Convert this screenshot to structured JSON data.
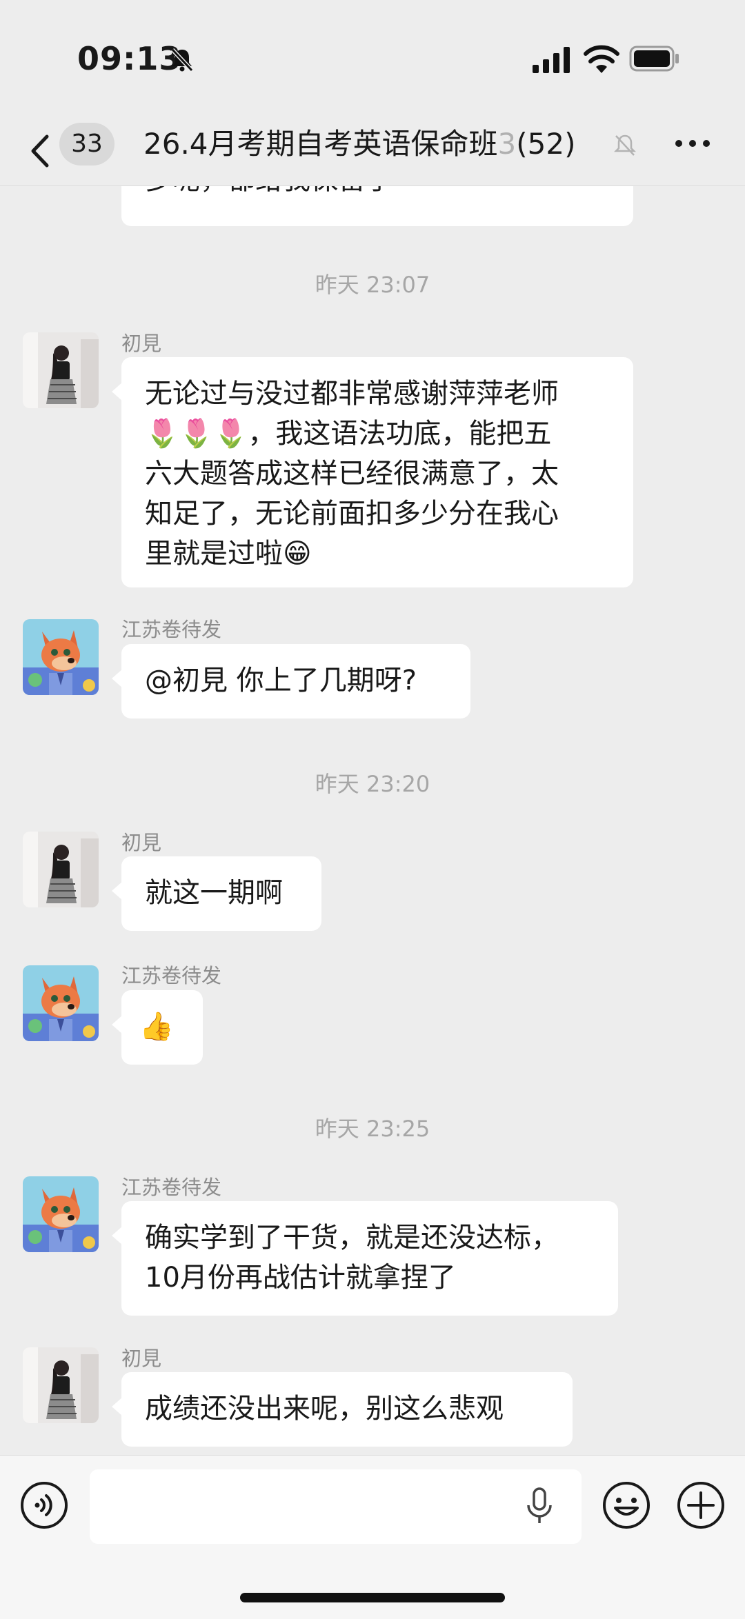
{
  "status_bar": {
    "time": "09:13",
    "icons": [
      "bell-slash-icon",
      "signal-icon",
      "wifi-icon",
      "battery-icon"
    ]
  },
  "header": {
    "back_icon": "chevron-left-icon",
    "unread_count": "33",
    "title_main": "26.4月考期自考英语保命班",
    "title_faded": "3",
    "member_count": "(52)",
    "mute_icon": "bell-slash-icon",
    "more_icon": "more-dots-icon"
  },
  "messages": {
    "partial_top": "多呢，都给我保留了",
    "ts1": "昨天 23:07",
    "m1": {
      "sender": "初見",
      "line1": "无论过与没过都非常感谢萍萍老师",
      "line2": "🌷🌷🌷，我这语法功底，能把五",
      "line3": "六大题答成这样已经很满意了，太",
      "line4": "知足了，无论前面扣多少分在我心",
      "line5": "里就是过啦😁"
    },
    "m2": {
      "sender": "江苏卷待发",
      "text": "@初見 你上了几期呀?"
    },
    "ts2": "昨天 23:20",
    "m3": {
      "sender": "初見",
      "text": "就这一期啊"
    },
    "m4": {
      "sender": "江苏卷待发",
      "text": "👍"
    },
    "ts3": "昨天 23:25",
    "m5": {
      "sender": "江苏卷待发",
      "line1": "确实学到了干货，就是还没达标，",
      "line2": "10月份再战估计就拿捏了"
    },
    "m6": {
      "sender": "初見",
      "text": "成绩还没出来呢，别这么悲观"
    }
  },
  "input_bar": {
    "voice_icon": "voice-mode-icon",
    "mic_icon": "microphone-icon",
    "emoji_icon": "emoji-icon",
    "plus_icon": "plus-icon"
  },
  "colors": {
    "background": "#ededed",
    "bubble": "#ffffff",
    "timestamp": "#a6a6a6",
    "sender": "#8c8c8c"
  }
}
